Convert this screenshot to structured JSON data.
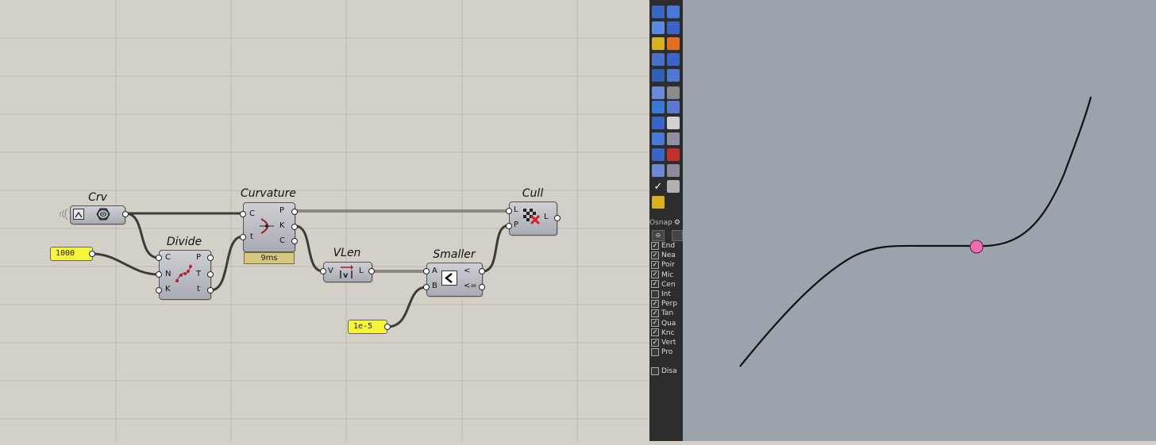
{
  "canvas": {
    "components": {
      "crv": {
        "title": "Crv"
      },
      "divide": {
        "title": "Divide",
        "inputs": [
          "C",
          "N",
          "K"
        ],
        "outputs": [
          "P",
          "T",
          "t"
        ]
      },
      "curvature": {
        "title": "Curvature",
        "inputs": [
          "C",
          "t"
        ],
        "outputs": [
          "P",
          "K",
          "C"
        ],
        "badge": "9ms"
      },
      "vlen": {
        "title": "VLen",
        "inputs": [
          "V"
        ],
        "outputs": [
          "L"
        ]
      },
      "smaller": {
        "title": "Smaller",
        "inputs": [
          "A",
          "B"
        ],
        "outputs": [
          "<",
          "<="
        ]
      },
      "cull": {
        "title": "Cull",
        "inputs": [
          "L",
          "P"
        ],
        "outputs": [
          "L"
        ]
      }
    },
    "panels": {
      "count_value": "1000",
      "tolerance_value": "1e-5"
    }
  },
  "toolbar": {
    "osnap": {
      "label": "Osnap",
      "items": [
        {
          "label": "End",
          "checked": true
        },
        {
          "label": "Nea",
          "checked": true
        },
        {
          "label": "Poir",
          "checked": true
        },
        {
          "label": "Mic",
          "checked": true
        },
        {
          "label": "Cen",
          "checked": true
        },
        {
          "label": "Int",
          "checked": false
        },
        {
          "label": "Perp",
          "checked": true
        },
        {
          "label": "Tan",
          "checked": true
        },
        {
          "label": "Qua",
          "checked": true
        },
        {
          "label": "Knc",
          "checked": true
        },
        {
          "label": "Vert",
          "checked": true
        },
        {
          "label": "Pro",
          "checked": false
        }
      ],
      "disable_label": "Disa"
    }
  },
  "viewport": {
    "curve_color": "#111111",
    "point_color": "#f06eb4"
  },
  "colors": {
    "canvas_bg": "#d4d0c8",
    "viewport_bg": "#9ba3ac",
    "panel_bg": "#f5f53c"
  }
}
